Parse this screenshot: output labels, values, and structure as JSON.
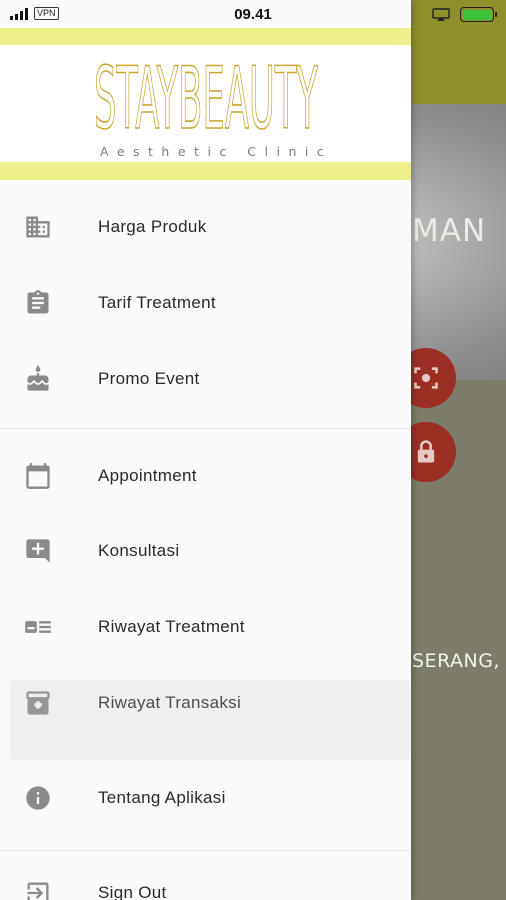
{
  "status_bar": {
    "carrier_badge": "VPN",
    "time": "09.41"
  },
  "background": {
    "hero_text": "MAN",
    "location_text": "SERANG,"
  },
  "drawer": {
    "logo": {
      "wordmark": "STAYBEAUTY",
      "subtitle": "Aesthetic Clinic"
    },
    "menu": [
      {
        "label": "Harga Produk",
        "icon": "building-icon"
      },
      {
        "label": "Tarif Treatment",
        "icon": "clipboard-icon"
      },
      {
        "label": "Promo Event",
        "icon": "cake-icon"
      },
      {
        "label": "Appointment",
        "icon": "calendar-icon"
      },
      {
        "label": "Konsultasi",
        "icon": "add-comment-icon"
      },
      {
        "label": "Riwayat Treatment",
        "icon": "id-card-list-icon"
      },
      {
        "label": "Riwayat Transaksi",
        "icon": "archive-icon"
      },
      {
        "label": "Tentang Aplikasi",
        "icon": "info-icon"
      },
      {
        "label": "Sign Out",
        "icon": "logout-icon"
      }
    ]
  },
  "colors": {
    "accent_stripe": "#eef08e",
    "logo_gold": "#c9a830",
    "fab_red": "#9b2f24",
    "header_olive": "#8f8f2c"
  }
}
